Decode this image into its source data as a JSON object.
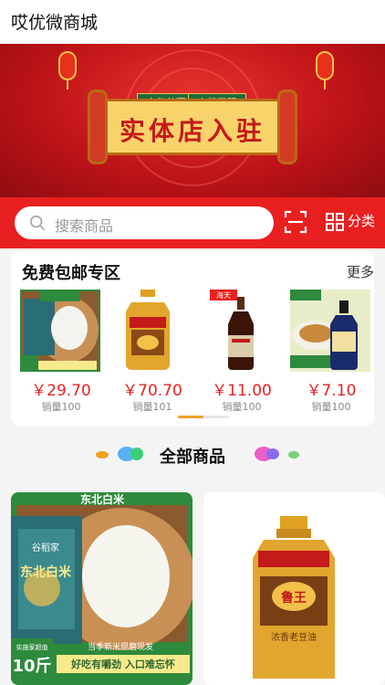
{
  "header": {
    "title": "哎优微商城"
  },
  "banner": {
    "headline": "实体店入驻",
    "tag_left": "合作共赢",
    "tag_right": "商机无限"
  },
  "search": {
    "placeholder": "搜索商品",
    "category_label": "分类"
  },
  "free_shipping": {
    "title": "免费包邮专区",
    "more_label": "更多",
    "products": [
      {
        "price": "￥29.70",
        "sold": "销量100",
        "image_text": "东北白米",
        "badge": "10斤",
        "caption": "好吃有嚼劲 入口难忘怀"
      },
      {
        "price": "￥70.70",
        "sold": "销量101",
        "image_text": "鲁王"
      },
      {
        "price": "￥11.00",
        "sold": "销量100",
        "image_text": "海天"
      },
      {
        "price": "￥7.10",
        "sold": "销量100",
        "image_text": "九味佳"
      }
    ]
  },
  "all_products": {
    "title": "全部商品",
    "items": [
      {
        "top_label": "东北白米",
        "bag_text": "东北白米",
        "brand": "谷稻家",
        "badge": "10斤",
        "badge_sub": "实施家超值",
        "promo": "当季新米现磨现发",
        "caption": "好吃有嚼劲 入口难忘怀"
      },
      {
        "brand": "鲁王",
        "label": "浓香老豆油"
      }
    ]
  },
  "colors": {
    "accent": "#e8201f",
    "price": "#e8201f",
    "indicator": "#f0a020"
  }
}
